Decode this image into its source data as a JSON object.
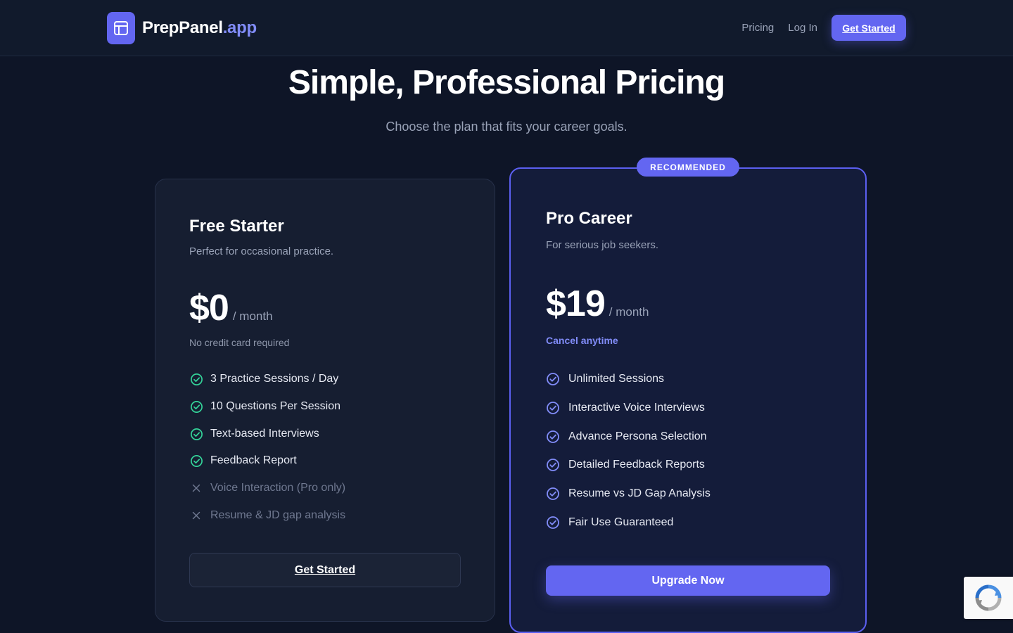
{
  "brand": {
    "name": "PrepPanel",
    "suffix": ".app",
    "accent_color": "#818cf8",
    "logo_icon": "layout-panel-icon"
  },
  "nav": {
    "pricing": "Pricing",
    "login": "Log In",
    "cta": "Get Started"
  },
  "hero": {
    "title": "Simple, Professional Pricing",
    "subtitle": "Choose the plan that fits your career goals."
  },
  "plans": {
    "free": {
      "name": "Free Starter",
      "description": "Perfect for occasional practice.",
      "price": "$0",
      "period": "/ month",
      "note": "No credit card required",
      "features": [
        {
          "label": "3 Practice Sessions / Day",
          "included": true
        },
        {
          "label": "10 Questions Per Session",
          "included": true
        },
        {
          "label": "Text-based Interviews",
          "included": true
        },
        {
          "label": "Feedback Report",
          "included": true
        },
        {
          "label": "Voice Interaction (Pro only)",
          "included": false
        },
        {
          "label": "Resume & JD gap analysis",
          "included": false
        }
      ],
      "cta": "Get Started"
    },
    "pro": {
      "badge": "RECOMMENDED",
      "name": "Pro Career",
      "description": "For serious job seekers.",
      "price": "$19",
      "period": "/ month",
      "note": "Cancel anytime",
      "features": [
        {
          "label": "Unlimited Sessions",
          "included": true
        },
        {
          "label": "Interactive Voice Interviews",
          "included": true
        },
        {
          "label": "Advance Persona Selection",
          "included": true
        },
        {
          "label": "Detailed Feedback Reports",
          "included": true
        },
        {
          "label": "Resume vs JD Gap Analysis",
          "included": true
        },
        {
          "label": "Fair Use Guaranteed",
          "included": true
        }
      ],
      "cta": "Upgrade Now"
    }
  },
  "colors": {
    "primary": "#6366f1",
    "check_free": "#34d399",
    "check_pro": "#818cf8",
    "background": "#0e1527"
  }
}
